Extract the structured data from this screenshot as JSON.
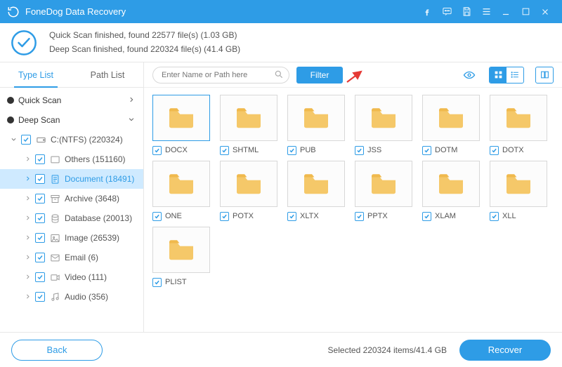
{
  "titlebar": {
    "app_name": "FoneDog Data Recovery"
  },
  "summary": {
    "line1": "Quick Scan finished, found 22577 file(s) (1.03 GB)",
    "line2": "Deep Scan finished, found 220324 file(s) (41.4 GB)"
  },
  "tabs": {
    "type_list": "Type List",
    "path_list": "Path List"
  },
  "tree": {
    "quick_scan": "Quick Scan",
    "deep_scan": "Deep Scan",
    "drive": "C:(NTFS) (220324)",
    "items": [
      {
        "label": "Others (151160)"
      },
      {
        "label": "Document (18491)",
        "active": true
      },
      {
        "label": "Archive (3648)"
      },
      {
        "label": "Database (20013)"
      },
      {
        "label": "Image (26539)"
      },
      {
        "label": "Email (6)"
      },
      {
        "label": "Video (111)"
      },
      {
        "label": "Audio (356)"
      }
    ]
  },
  "toolbar": {
    "search_placeholder": "Enter Name or Path here",
    "filter": "Filter"
  },
  "grid": {
    "row1": [
      "DOCX",
      "SHTML",
      "PUB",
      "JSS",
      "DOTM",
      "DOTX"
    ],
    "row2": [
      "ONE",
      "POTX",
      "XLTX",
      "PPTX",
      "XLAM",
      "XLL"
    ],
    "row3": [
      "PLIST"
    ]
  },
  "footer": {
    "back": "Back",
    "selected": "Selected 220324 items/41.4 GB",
    "recover": "Recover"
  }
}
